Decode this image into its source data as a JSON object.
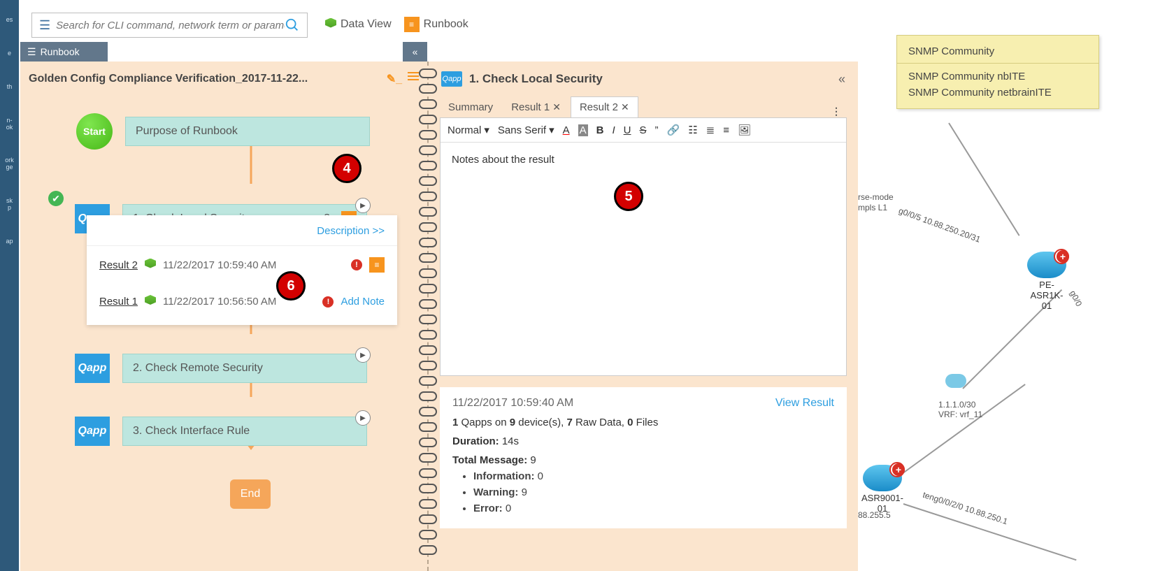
{
  "search": {
    "placeholder": "Search for CLI command, network term or parameter"
  },
  "toolbar": {
    "data_view": "Data View",
    "runbook": "Runbook"
  },
  "runbook_tab": "Runbook",
  "runbook_title": "Golden Config Compliance Verification_2017-11-22...",
  "flow": {
    "start": "Start",
    "purpose": "Purpose of Runbook",
    "step1": {
      "label": "1. Check Local Security",
      "count": "2"
    },
    "desc_link": "Description >>",
    "results": {
      "r2": {
        "name": "Result 2",
        "ts": "11/22/2017 10:59:40 AM"
      },
      "r1": {
        "name": "Result 1",
        "ts": "11/22/2017 10:56:50 AM",
        "add_note": "Add Note"
      }
    },
    "step2": "2. Check Remote Security",
    "step3": "3. Check Interface Rule",
    "end": "End"
  },
  "detail": {
    "title": "1. Check Local Security",
    "tabs": {
      "summary": "Summary",
      "r1": "Result 1",
      "r2": "Result 2"
    },
    "editor": {
      "style": "Normal",
      "font": "Sans Serif",
      "note": "Notes about the result"
    },
    "meta": {
      "ts": "11/22/2017 10:59:40 AM",
      "view": "View Result",
      "summary_line": {
        "qapps": "1",
        "devices": "9",
        "raw": "7",
        "files": "0"
      },
      "duration_label": "Duration:",
      "duration_val": "14s",
      "total_label": "Total Message:",
      "total_val": "9",
      "info_label": "Information:",
      "info_val": "0",
      "warn_label": "Warning:",
      "warn_val": "9",
      "err_label": "Error:",
      "err_val": "0"
    }
  },
  "topo": {
    "snmp_title": "SNMP Community",
    "snmp_l1": "SNMP Community nbITE",
    "snmp_l2": "SNMP Community netbrainITE",
    "pe": "PE-ASR1K-01",
    "asr": "ASR9001-01",
    "sub": "1.1.1.0/30",
    "vrf": "VRF: vrf_11",
    "ip1": "88.255.5",
    "link1": "g0/0/5 10.88.250.20/31",
    "link2": "teng0/0/2/0 10.88.250.1",
    "mode1": "rse-mode",
    "mode2": "mpls L1",
    "g00": "g0/0"
  },
  "callouts": {
    "c4": "4",
    "c5": "5",
    "c6": "6"
  }
}
